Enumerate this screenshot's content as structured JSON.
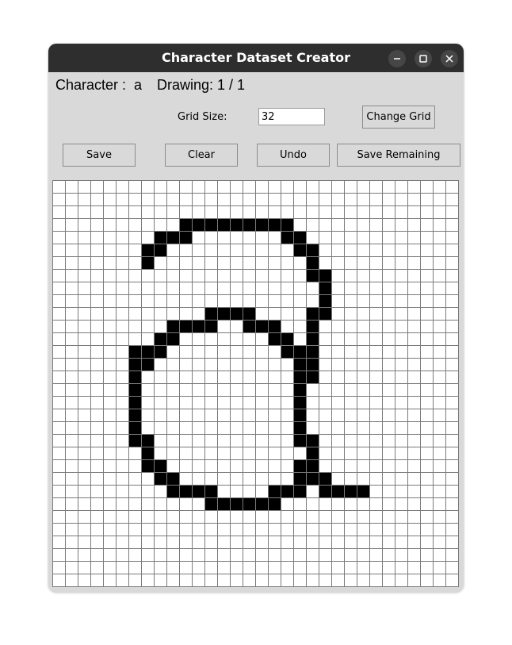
{
  "window": {
    "title": "Character Dataset Creator"
  },
  "status": {
    "character_label": "Character :  a",
    "drawing_label": "Drawing: 1 / 1"
  },
  "grid_size": {
    "label": "Grid Size:",
    "value": "32",
    "change_button": "Change Grid"
  },
  "toolbar": {
    "save_label": "Save",
    "clear_label": "Clear",
    "undo_label": "Undo",
    "save_remaining_label": "Save Remaining"
  },
  "canvas": {
    "rows": 32,
    "cols": 32,
    "filled_cells": [
      [
        3,
        10
      ],
      [
        3,
        11
      ],
      [
        3,
        12
      ],
      [
        3,
        13
      ],
      [
        3,
        14
      ],
      [
        3,
        15
      ],
      [
        3,
        16
      ],
      [
        3,
        17
      ],
      [
        3,
        18
      ],
      [
        4,
        8
      ],
      [
        4,
        9
      ],
      [
        4,
        10
      ],
      [
        4,
        18
      ],
      [
        4,
        19
      ],
      [
        5,
        7
      ],
      [
        5,
        8
      ],
      [
        5,
        19
      ],
      [
        5,
        20
      ],
      [
        6,
        7
      ],
      [
        6,
        20
      ],
      [
        7,
        20
      ],
      [
        7,
        21
      ],
      [
        8,
        21
      ],
      [
        9,
        21
      ],
      [
        10,
        12
      ],
      [
        10,
        13
      ],
      [
        10,
        14
      ],
      [
        10,
        15
      ],
      [
        10,
        20
      ],
      [
        10,
        21
      ],
      [
        11,
        9
      ],
      [
        11,
        10
      ],
      [
        11,
        11
      ],
      [
        11,
        12
      ],
      [
        11,
        15
      ],
      [
        11,
        16
      ],
      [
        11,
        17
      ],
      [
        11,
        20
      ],
      [
        12,
        8
      ],
      [
        12,
        9
      ],
      [
        12,
        17
      ],
      [
        12,
        18
      ],
      [
        12,
        20
      ],
      [
        13,
        6
      ],
      [
        13,
        7
      ],
      [
        13,
        8
      ],
      [
        13,
        18
      ],
      [
        13,
        19
      ],
      [
        13,
        20
      ],
      [
        14,
        6
      ],
      [
        14,
        7
      ],
      [
        14,
        19
      ],
      [
        14,
        20
      ],
      [
        15,
        6
      ],
      [
        15,
        19
      ],
      [
        15,
        20
      ],
      [
        16,
        6
      ],
      [
        16,
        19
      ],
      [
        17,
        6
      ],
      [
        17,
        19
      ],
      [
        18,
        6
      ],
      [
        18,
        19
      ],
      [
        19,
        6
      ],
      [
        19,
        19
      ],
      [
        20,
        6
      ],
      [
        20,
        7
      ],
      [
        20,
        19
      ],
      [
        20,
        20
      ],
      [
        21,
        7
      ],
      [
        21,
        20
      ],
      [
        22,
        7
      ],
      [
        22,
        8
      ],
      [
        22,
        19
      ],
      [
        22,
        20
      ],
      [
        23,
        8
      ],
      [
        23,
        9
      ],
      [
        23,
        19
      ],
      [
        23,
        20
      ],
      [
        23,
        21
      ],
      [
        24,
        9
      ],
      [
        24,
        10
      ],
      [
        24,
        11
      ],
      [
        24,
        12
      ],
      [
        24,
        17
      ],
      [
        24,
        18
      ],
      [
        24,
        19
      ],
      [
        24,
        21
      ],
      [
        24,
        22
      ],
      [
        24,
        23
      ],
      [
        24,
        24
      ],
      [
        25,
        12
      ],
      [
        25,
        13
      ],
      [
        25,
        14
      ],
      [
        25,
        15
      ],
      [
        25,
        16
      ],
      [
        25,
        17
      ]
    ]
  },
  "colors": {
    "titlebar": "#2e2e2e",
    "window_bg": "#d9d9d9",
    "grid_line": "#7a7a7a",
    "cell_fill": "#000000",
    "cell_empty": "#ffffff"
  },
  "icons": {
    "minimize": "minimize-icon",
    "maximize": "maximize-icon",
    "close": "close-icon"
  }
}
